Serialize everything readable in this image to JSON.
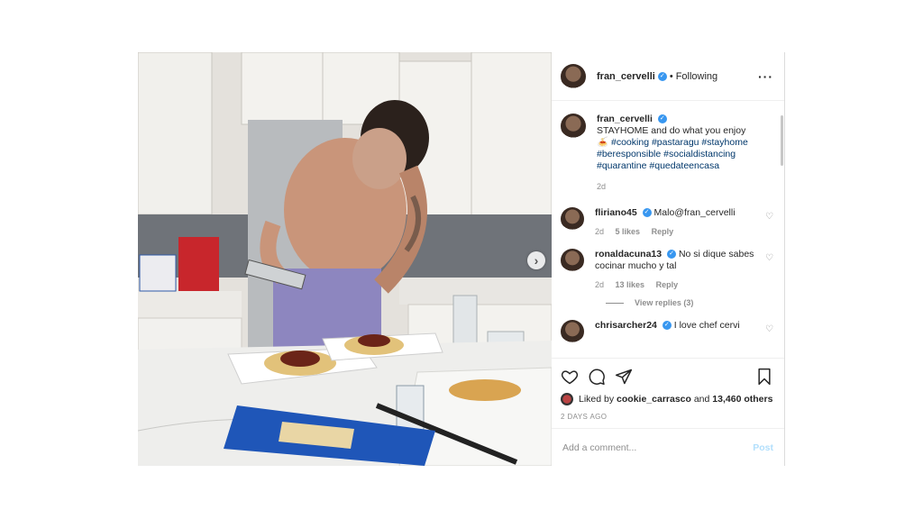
{
  "header": {
    "username": "fran_cervelli",
    "separator": "•",
    "follow_status": "Following",
    "more_icon": "more-horizontal-icon"
  },
  "caption": {
    "username": "fran_cervelli",
    "text_line1": "STAYHOME and do what you enjoy",
    "emoji": "🍝",
    "hashtags": [
      "#cooking",
      "#pastaragu",
      "#stayhome",
      "#beresponsible",
      "#socialdistancing",
      "#quarantine",
      "#quedateencasa"
    ],
    "time": "2d"
  },
  "comments": [
    {
      "username": "fliriano45",
      "verified": true,
      "text": "Malo@fran_cervelli",
      "time": "2d",
      "likes": "5 likes",
      "reply": "Reply"
    },
    {
      "username": "ronaldacuna13",
      "verified": true,
      "text": "No si dique sabes cocinar mucho y tal",
      "time": "2d",
      "likes": "13 likes",
      "reply": "Reply",
      "view_replies": "View replies (3)"
    },
    {
      "username": "chrisarcher24",
      "verified": true,
      "text": "I love chef cervi"
    }
  ],
  "actions": {
    "liked_prefix": "Liked by",
    "liked_user": "cookie_carrasco",
    "liked_and": "and",
    "liked_count": "13,460 others",
    "timestamp": "2 DAYS AGO"
  },
  "add_comment": {
    "placeholder": "Add a comment...",
    "post_label": "Post"
  },
  "colors": {
    "verified": "#3897f0",
    "link": "#00376b",
    "post_button_disabled": "#b2dffc"
  }
}
